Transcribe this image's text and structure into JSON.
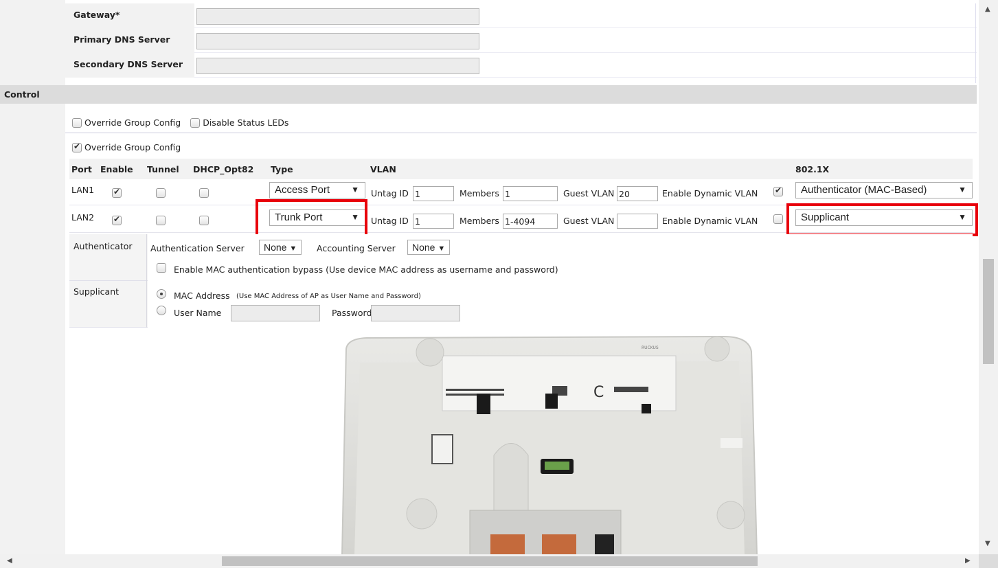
{
  "network": {
    "gateway_label": "Gateway*",
    "primary_dns_label": "Primary DNS Server",
    "secondary_dns_label": "Secondary DNS Server",
    "gateway_value": "",
    "primary_dns_value": "",
    "secondary_dns_value": ""
  },
  "control": {
    "section_title": "Control",
    "override_group_config_label": "Override Group Config",
    "disable_status_leds_label": "Disable Status LEDs",
    "override_group_config_ports_label": "Override Group Config"
  },
  "ports": {
    "headers": {
      "port": "Port",
      "enable": "Enable",
      "tunnel": "Tunnel",
      "dhcp": "DHCP_Opt82",
      "type": "Type",
      "vlan": "VLAN",
      "dot1x": "802.1X"
    },
    "rows": [
      {
        "name": "LAN1",
        "enable": true,
        "tunnel": false,
        "dhcp": false,
        "type": "Access Port",
        "untag_label": "Untag ID",
        "untag_id": "1",
        "members_label": "Members",
        "members": "1",
        "guest_label": "Guest VLAN",
        "guest_vlan": "20",
        "dynamic_label": "Enable Dynamic VLAN",
        "dynamic": true,
        "dot1x": "Authenticator (MAC-Based)"
      },
      {
        "name": "LAN2",
        "enable": true,
        "tunnel": false,
        "dhcp": false,
        "type": "Trunk Port",
        "untag_label": "Untag ID",
        "untag_id": "1",
        "members_label": "Members",
        "members": "1-4094",
        "guest_label": "Guest VLAN",
        "guest_vlan": "",
        "dynamic_label": "Enable Dynamic VLAN",
        "dynamic": false,
        "dot1x": "Supplicant"
      }
    ]
  },
  "authenticator": {
    "label": "Authenticator",
    "auth_server_label": "Authentication Server",
    "auth_server_value": "None",
    "acct_server_label": "Accounting Server",
    "acct_server_value": "None",
    "mac_bypass_label": "Enable MAC authentication bypass (Use device MAC address as username and password)"
  },
  "supplicant": {
    "label": "Supplicant",
    "mac_address_label": "MAC Address",
    "mac_address_note": "(Use MAC Address of AP as User Name and Password)",
    "user_name_label": "User Name",
    "password_label": "Password",
    "selected": "mac_address"
  },
  "icons": {
    "dropdown": "chevron-down-icon",
    "scroll_up": "arrow-up-icon",
    "scroll_down": "arrow-down-icon",
    "scroll_left": "arrow-left-icon",
    "scroll_right": "arrow-right-icon"
  },
  "colors": {
    "highlight": "#e8000b",
    "label_bg": "#f2f2f2",
    "section_bar": "#dcdcdc",
    "disabled_field": "#ececec"
  }
}
